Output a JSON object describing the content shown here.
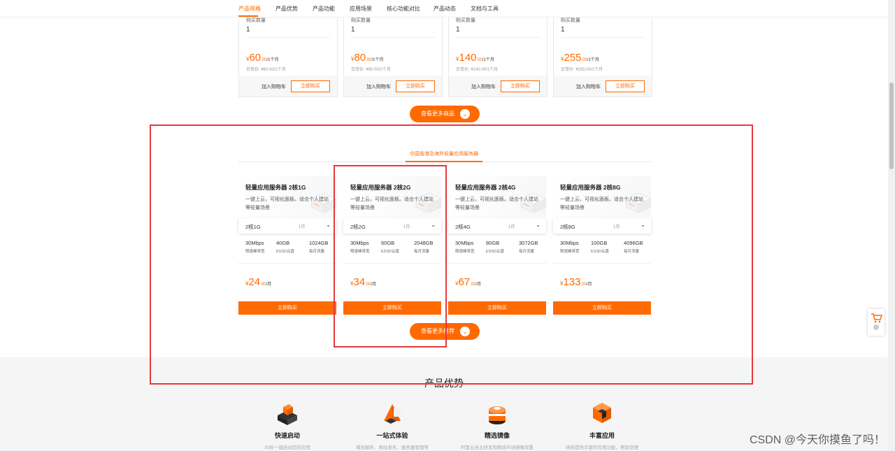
{
  "nav": {
    "tabs": [
      "产品规格",
      "产品优势",
      "产品功能",
      "应用场景",
      "核心功能对比",
      "产品动态",
      "文档与工具"
    ],
    "active": "产品规格"
  },
  "top_cards": [
    {
      "qty_label": "购买数量",
      "qty": "1",
      "yen": "¥",
      "price": "60",
      "decimal": ".00",
      "unit": "/1个月",
      "original": "日常价: ¥60.00/1个月",
      "cart": "加入购物车",
      "buy": "立即购买"
    },
    {
      "qty_label": "购买数量",
      "qty": "1",
      "yen": "¥",
      "price": "80",
      "decimal": ".00",
      "unit": "/1个月",
      "original": "日常价: ¥80.00/1个月",
      "cart": "加入购物车",
      "buy": "立即购买"
    },
    {
      "qty_label": "购买数量",
      "qty": "1",
      "yen": "¥",
      "price": "140",
      "decimal": ".00",
      "unit": "/1个月",
      "original": "日常价: ¥140.00/1个月",
      "cart": "加入购物车",
      "buy": "立即购买"
    },
    {
      "qty_label": "购买数量",
      "qty": "1",
      "yen": "¥",
      "price": "255",
      "decimal": ".00",
      "unit": "/1个月",
      "original": "日常价: ¥255.00/1个月",
      "cart": "加入购物车",
      "buy": "立即购买"
    }
  ],
  "more_products": "查看更多商品",
  "section_tab": "中国香港及海外轻量应用服务器",
  "products": [
    {
      "title": "轻量应用服务器 2核1G",
      "desc": "一键上云，可视化面板。适合个人建站等轻量场景",
      "config": "2核1G",
      "period": "1月",
      "specs": [
        {
          "v": "30Mbps",
          "l": "限速峰带宽"
        },
        {
          "v": "40GB",
          "l": "ESSD云盘"
        },
        {
          "v": "1024GB",
          "l": "每月流量"
        }
      ],
      "yen": "¥",
      "price": "24",
      "decimal": ".00",
      "unit": "/月",
      "buy": "立即购买"
    },
    {
      "title": "轻量应用服务器 2核2G",
      "desc": "一键上云，可视化面板。适合个人建站等轻量场景",
      "config": "2核2G",
      "period": "1月",
      "specs": [
        {
          "v": "30Mbps",
          "l": "限速峰带宽"
        },
        {
          "v": "60GB",
          "l": "ESSD云盘"
        },
        {
          "v": "2048GB",
          "l": "每月流量"
        }
      ],
      "yen": "¥",
      "price": "34",
      "decimal": ".00",
      "unit": "/月",
      "buy": "立即购买"
    },
    {
      "title": "轻量应用服务器 2核4G",
      "desc": "一键上云，可视化面板。适合个人建站等轻量场景",
      "config": "2核4G",
      "period": "1月",
      "specs": [
        {
          "v": "30Mbps",
          "l": "限速峰带宽"
        },
        {
          "v": "80GB",
          "l": "ESSD云盘"
        },
        {
          "v": "3072GB",
          "l": "每月流量"
        }
      ],
      "yen": "¥",
      "price": "67",
      "decimal": ".00",
      "unit": "/月",
      "buy": "立即购买"
    },
    {
      "title": "轻量应用服务器 2核8G",
      "desc": "一键上云，可视化面板。适合个人建站等轻量场景",
      "config": "2核8G",
      "period": "1月",
      "specs": [
        {
          "v": "30Mbps",
          "l": "限速峰带宽"
        },
        {
          "v": "100GB",
          "l": "ESSD云盘"
        },
        {
          "v": "4096GB",
          "l": "每月流量"
        }
      ],
      "yen": "¥",
      "price": "133",
      "decimal": ".00",
      "unit": "/月",
      "buy": "立即购买"
    }
  ],
  "more_recommend": "查看更多推荐",
  "advantages": {
    "title": "产品优势",
    "items": [
      {
        "icon": "rocket-cube-icon",
        "title": "快速启动",
        "sub": "30秒一键启动您的应用"
      },
      {
        "icon": "one-stop-icon",
        "title": "一站式体验",
        "sub": "域名解析、网站发布、服务器管理等"
      },
      {
        "icon": "image-disk-icon",
        "title": "精选镜像",
        "sub": "阿里云自主研发和精选市场镜像双重"
      },
      {
        "icon": "app-cube-icon",
        "title": "丰富应用",
        "sub": "持续提供丰富的应用功能，帮助您便"
      }
    ]
  },
  "watermark": "CSDN @今天你摸鱼了吗！",
  "colors": {
    "accent": "#ff6a00",
    "annotation": "#e4393c"
  }
}
